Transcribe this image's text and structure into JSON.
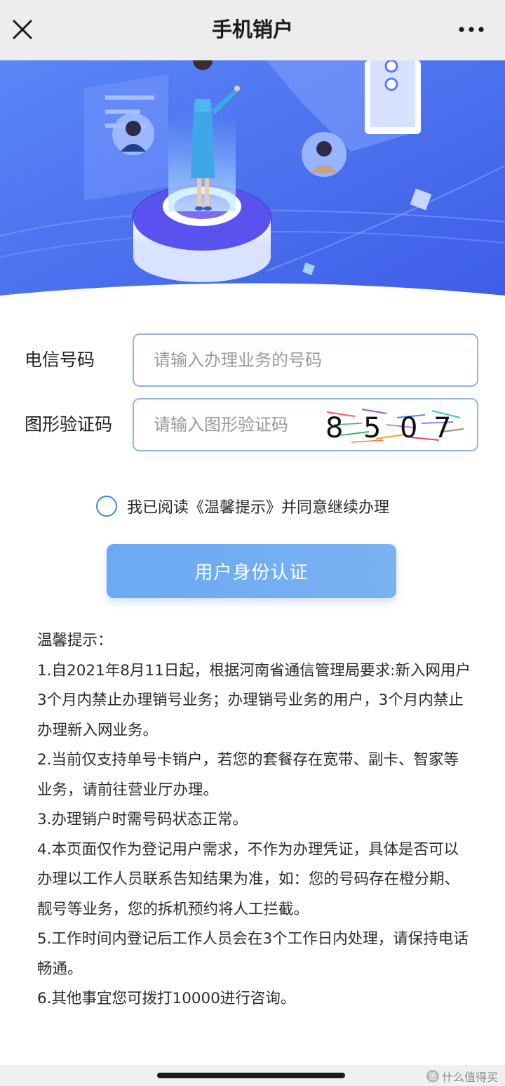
{
  "nav": {
    "title": "手机销户",
    "close_icon": "close-icon",
    "more_icon": "more-dots-icon"
  },
  "banner": {
    "theme_color": "#4b6cf2",
    "illustration": "business-hall-illustration"
  },
  "form": {
    "phone": {
      "label": "电信号码",
      "placeholder": "请输入办理业务的号码",
      "value": ""
    },
    "captcha": {
      "label": "图形验证码",
      "placeholder": "请输入图形验证码",
      "value": "",
      "image_text": [
        "8",
        "5",
        "0",
        "7"
      ]
    }
  },
  "agreement": {
    "text": "我已阅读《温馨提示》并同意继续办理",
    "checked": false
  },
  "button": {
    "label": "用户身份认证"
  },
  "notice": {
    "title": "温馨提示：",
    "items": [
      "1.自2021年8月11日起，根据河南省通信管理局要求:新入网用户3个月内禁止办理销号业务；办理销号业务的用户，3个月内禁止办理新入网业务。",
      "2.当前仅支持单号卡销户，若您的套餐存在宽带、副卡、智家等业务，请前往营业厅办理。",
      "3.办理销户时需号码状态正常。",
      "4.本页面仅作为登记用户需求，不作为办理凭证，具体是否可以办理以工作人员联系告知结果为准，如：您的号码存在橙分期、靓号等业务，您的拆机预约将人工拦截。",
      "5.工作时间内登记后工作人员会在3个工作日内处理，请保持电话畅通。",
      "6.其他事宜您可拨打10000进行咨询。"
    ]
  },
  "footer": {
    "watermark": "什么值得买",
    "watermark_icon": "值"
  },
  "colors": {
    "accent": "#3b86e0",
    "button": "#6ba9f4",
    "input_border": "#93b4e8"
  }
}
